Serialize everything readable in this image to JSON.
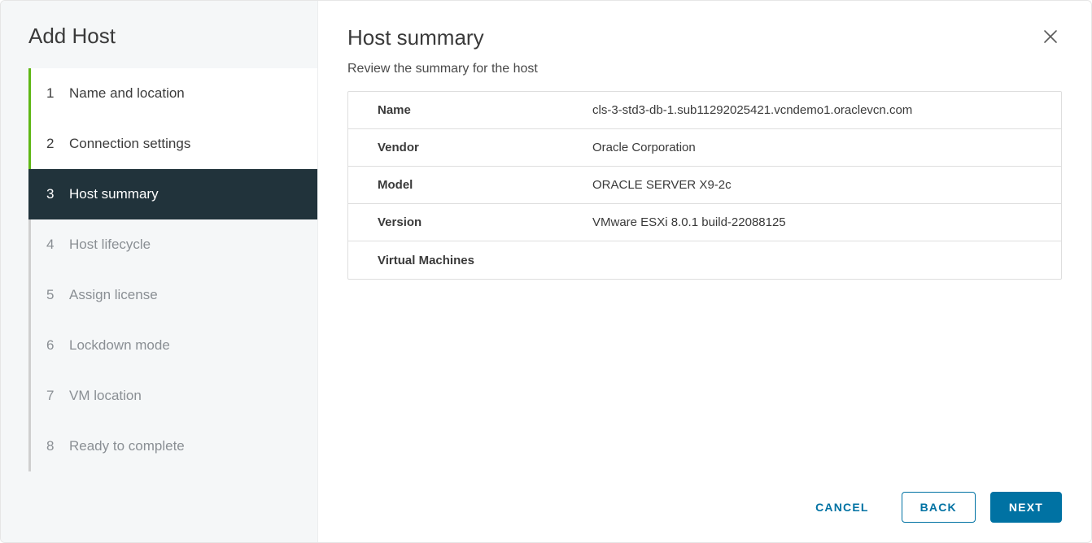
{
  "wizard_title": "Add Host",
  "steps": [
    {
      "num": "1",
      "label": "Name and location"
    },
    {
      "num": "2",
      "label": "Connection settings"
    },
    {
      "num": "3",
      "label": "Host summary"
    },
    {
      "num": "4",
      "label": "Host lifecycle"
    },
    {
      "num": "5",
      "label": "Assign license"
    },
    {
      "num": "6",
      "label": "Lockdown mode"
    },
    {
      "num": "7",
      "label": "VM location"
    },
    {
      "num": "8",
      "label": "Ready to complete"
    }
  ],
  "main": {
    "title": "Host summary",
    "subtitle": "Review the summary for the host",
    "rows": [
      {
        "label": "Name",
        "value": "cls-3-std3-db-1.sub11292025421.vcndemo1.oraclevcn.com"
      },
      {
        "label": "Vendor",
        "value": "Oracle Corporation"
      },
      {
        "label": "Model",
        "value": "ORACLE SERVER X9-2c"
      },
      {
        "label": "Version",
        "value": "VMware ESXi 8.0.1 build-22088125"
      },
      {
        "label": "Virtual Machines",
        "value": ""
      }
    ]
  },
  "footer": {
    "cancel": "CANCEL",
    "back": "BACK",
    "next": "NEXT"
  }
}
